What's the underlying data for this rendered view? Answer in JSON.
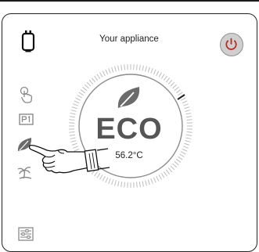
{
  "header": {
    "title": "Your appliance"
  },
  "dial": {
    "mode": "ECO",
    "temperature": "56.2°C"
  },
  "sidebar": {
    "items": [
      {
        "name": "water-heater-icon"
      },
      {
        "name": "touch-icon"
      },
      {
        "name": "p1-program-icon"
      },
      {
        "name": "eco-leaf-icon"
      },
      {
        "name": "vacation-palm-icon"
      },
      {
        "name": "settings-sliders-icon"
      }
    ]
  },
  "colors": {
    "icon_gray": "#8a8a8a",
    "text_dark": "#1e1e1e",
    "eco_gray": "#555555",
    "power_button": "#cfcfcf",
    "power_icon": "#c02820"
  }
}
